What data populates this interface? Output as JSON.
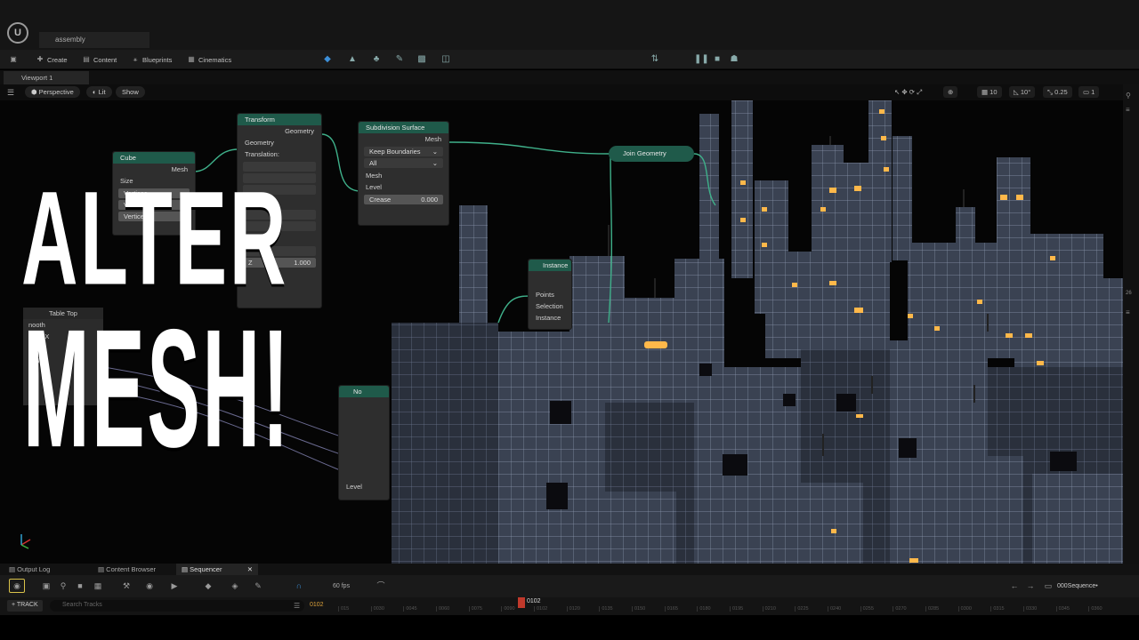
{
  "app": {
    "document_tab": "assembly",
    "logo": "ue-logo"
  },
  "toolbar": {
    "create": "Create",
    "content": "Content",
    "blueprints": "Blueprints",
    "cinematics": "Cinematics"
  },
  "viewport_tab": "Viewport 1",
  "viewport_bar": {
    "perspective": "Perspective",
    "lit": "Lit",
    "show": "Show",
    "grid_snap": "10",
    "rot_snap": "10°",
    "scale_snap": "0.25",
    "cam_speed": "1"
  },
  "nodes": {
    "cube": {
      "title": "Cube",
      "mesh": "Mesh",
      "size": "Size",
      "v1": "Vertices",
      "v2": "Vertices",
      "v3": "Vertices"
    },
    "transform": {
      "title": "Transform",
      "geometry_out": "Geometry",
      "geometry_in": "Geometry",
      "translation": "Translation:",
      "rotation": "Rota",
      "scale": "Sca",
      "z_label": "Z",
      "z_value": "1.000"
    },
    "subdivision": {
      "title": "Subdivision Surface",
      "mesh_out": "Mesh",
      "boundary": "Keep Boundaries",
      "smooth": "All",
      "mesh_in": "Mesh",
      "level": "Level",
      "crease": "Crease",
      "crease_value": "0.000"
    },
    "join": {
      "title": "Join Geometry"
    },
    "instance": {
      "title": "Instance",
      "points": "Points",
      "selection": "Selection",
      "instance": "Instance"
    },
    "noise": {
      "title": "No",
      "level": "Level"
    }
  },
  "table_panel": {
    "header": "Table Top",
    "rows": [
      "nooth",
      "Legs X",
      "egs Y",
      "Legs",
      "oth"
    ]
  },
  "headline": {
    "line1": "ALTER",
    "line2": "MESH!"
  },
  "bottom_tabs": {
    "output_log": "Output Log",
    "content_browser": "Content Browser",
    "sequencer": "Sequencer"
  },
  "sequencer": {
    "fps": "60 fps",
    "sequence_name": "000Sequence•",
    "track_button": "+ TRACK",
    "search_placeholder": "Search Tracks",
    "current_frame": "0102",
    "playhead_frame": "0102"
  },
  "ruler_ticks": [
    "015",
    "0030",
    "0045",
    "0060",
    "0075",
    "0090",
    "0102",
    "0120",
    "0135",
    "0150",
    "0165",
    "0180",
    "0195",
    "0210",
    "0225",
    "0240",
    "0255",
    "0270",
    "0285",
    "0300",
    "0315",
    "0330",
    "0345",
    "0360"
  ],
  "right_sidebar": {
    "value": "26"
  },
  "colors": {
    "node_header": "#1f5a4a",
    "socket": "#3fb08a",
    "window_glow": "#ffb84a",
    "building": "#3a4252",
    "playhead": "#c0392b"
  }
}
